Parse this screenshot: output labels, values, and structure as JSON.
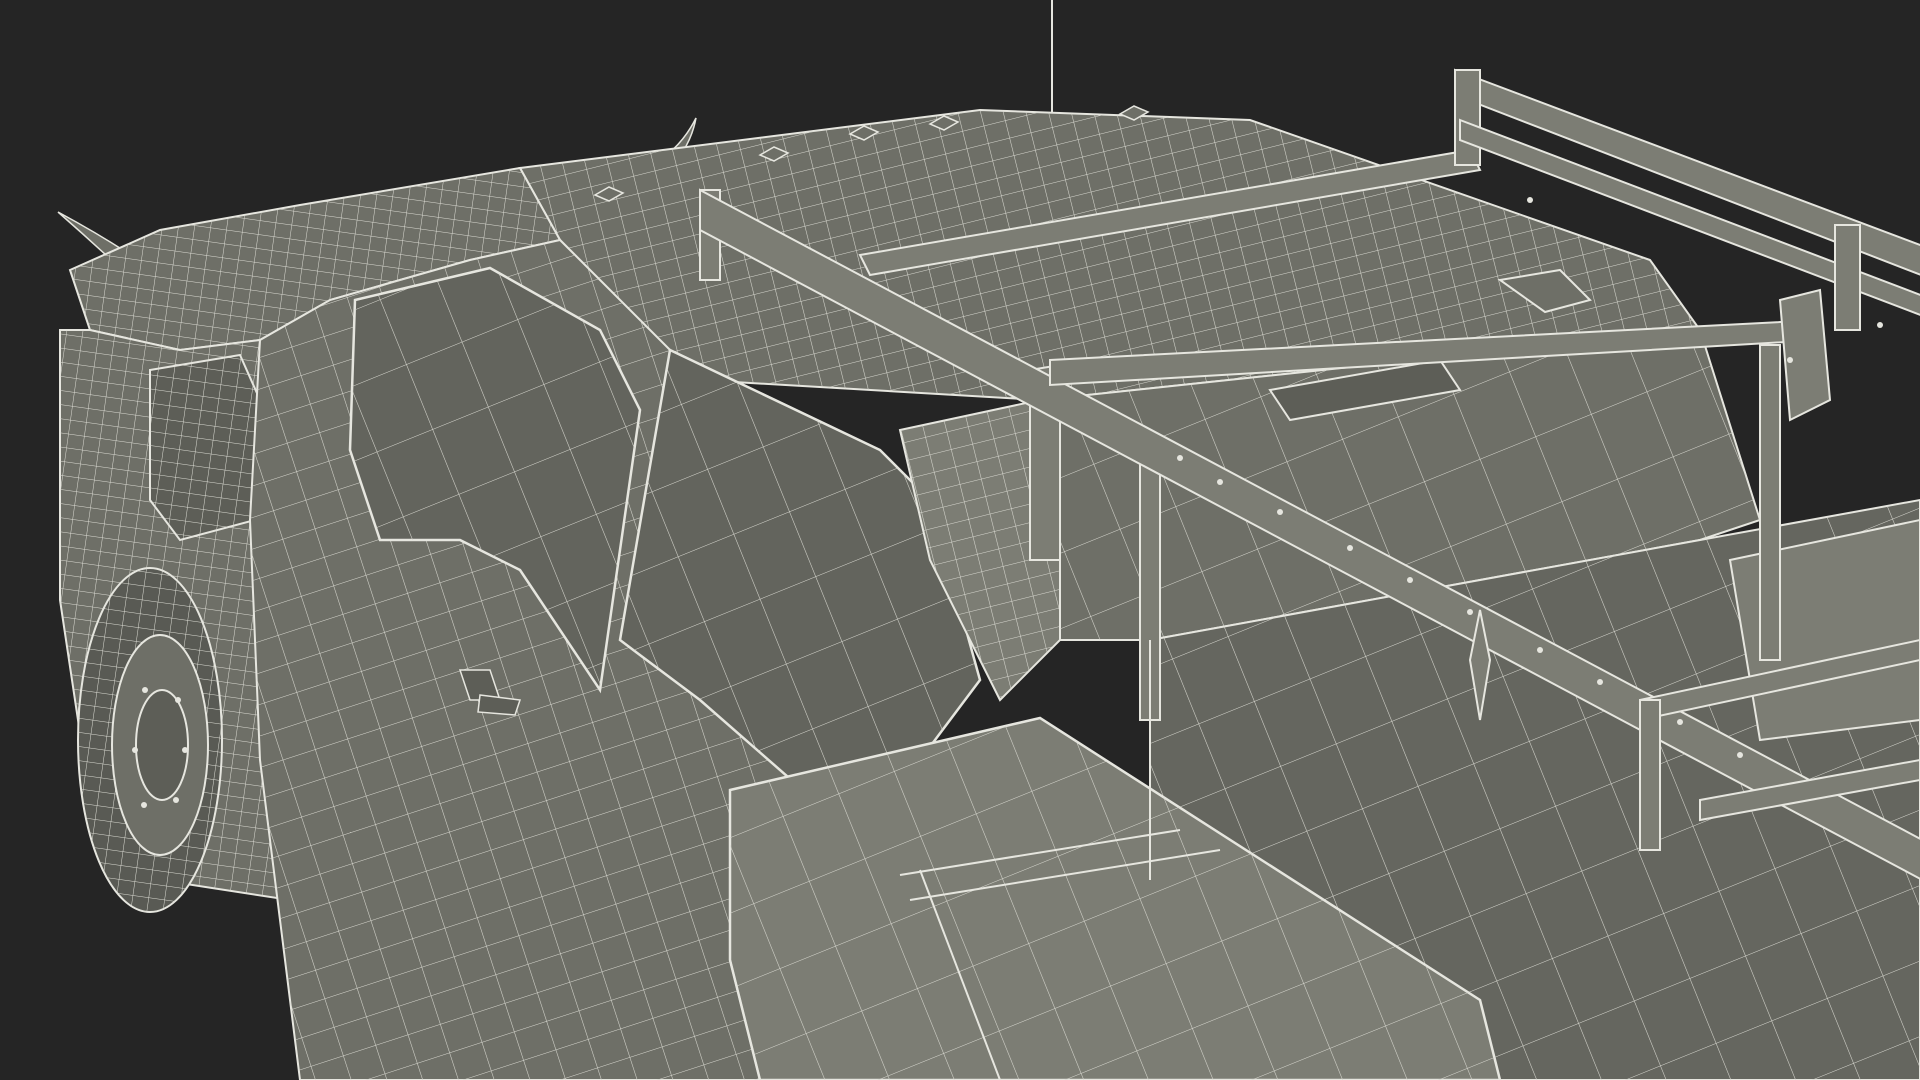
{
  "scene": {
    "subject": "pickup-truck-wireframe-render",
    "colors": {
      "background": "#252525",
      "surface": "#6e6f67",
      "surface_light": "#7c7d74",
      "surface_dark": "#5d5e57",
      "wire": "#e6e6df",
      "window": "#63645d",
      "tire": "#595a54"
    }
  }
}
